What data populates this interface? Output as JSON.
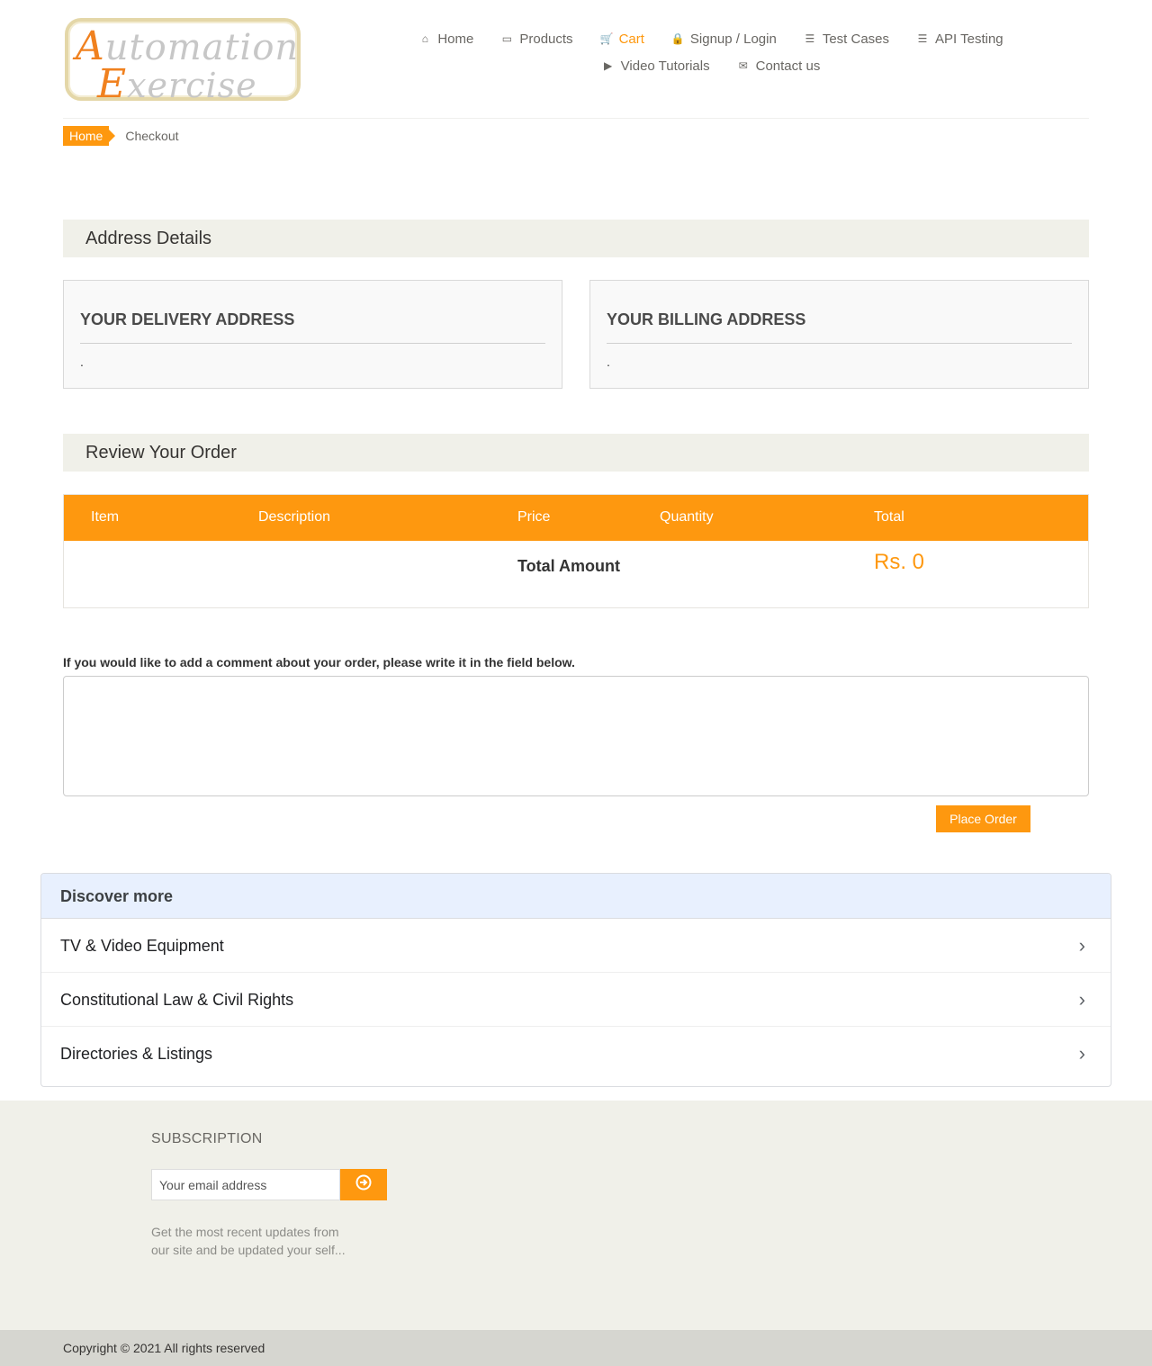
{
  "logo": {
    "line1_accent": "A",
    "line1_rest": "utomation",
    "line2_accent": "E",
    "line2_rest": "xercise"
  },
  "nav": {
    "row1": [
      {
        "icon": "home-icon",
        "glyph": "⌂",
        "label": "Home"
      },
      {
        "icon": "briefcase-icon",
        "glyph": "▭",
        "label": "Products"
      },
      {
        "icon": "cart-icon",
        "glyph": "🛒",
        "label": "Cart"
      },
      {
        "icon": "lock-icon",
        "glyph": "🔒",
        "label": "Signup / Login"
      },
      {
        "icon": "list-icon",
        "glyph": "☰",
        "label": "Test Cases"
      },
      {
        "icon": "list-icon",
        "glyph": "☰",
        "label": "API Testing"
      }
    ],
    "row2": [
      {
        "icon": "youtube-play-icon",
        "glyph": "▶",
        "label": "Video Tutorials"
      },
      {
        "icon": "envelope-icon",
        "glyph": "✉",
        "label": "Contact us"
      }
    ],
    "active_label": "Cart",
    "active_color": "#fe980f"
  },
  "breadcrumb": {
    "home": "Home",
    "current": "Checkout"
  },
  "address_section": {
    "title": "Address Details",
    "delivery": {
      "title": "YOUR DELIVERY ADDRESS",
      "value": "."
    },
    "billing": {
      "title": "YOUR BILLING ADDRESS",
      "value": "."
    }
  },
  "review_section": {
    "title": "Review Your Order",
    "columns": [
      "Item",
      "Description",
      "Price",
      "Quantity",
      "Total"
    ],
    "total_label": "Total Amount",
    "total_value": "Rs. 0"
  },
  "comment": {
    "label": "If you would like to add a comment about your order, please write it in the field below.",
    "value": "",
    "place_order_label": "Place Order"
  },
  "discover": {
    "title": "Discover more",
    "items": [
      "TV & Video Equipment",
      "Constitutional Law & Civil Rights",
      "Directories & Listings"
    ]
  },
  "footer": {
    "subscription_title": "SUBSCRIPTION",
    "email_placeholder": "Your email address",
    "subscribe_icon": "arrow-circle-right-icon",
    "subscription_text": "Get the most recent updates from our site and be updated your self...",
    "copyright": "Copyright © 2021 All rights reserved"
  },
  "colors": {
    "accent": "#fe980f",
    "section_bg": "#f0f0e9",
    "discover_head_bg": "#e8f0fe"
  }
}
